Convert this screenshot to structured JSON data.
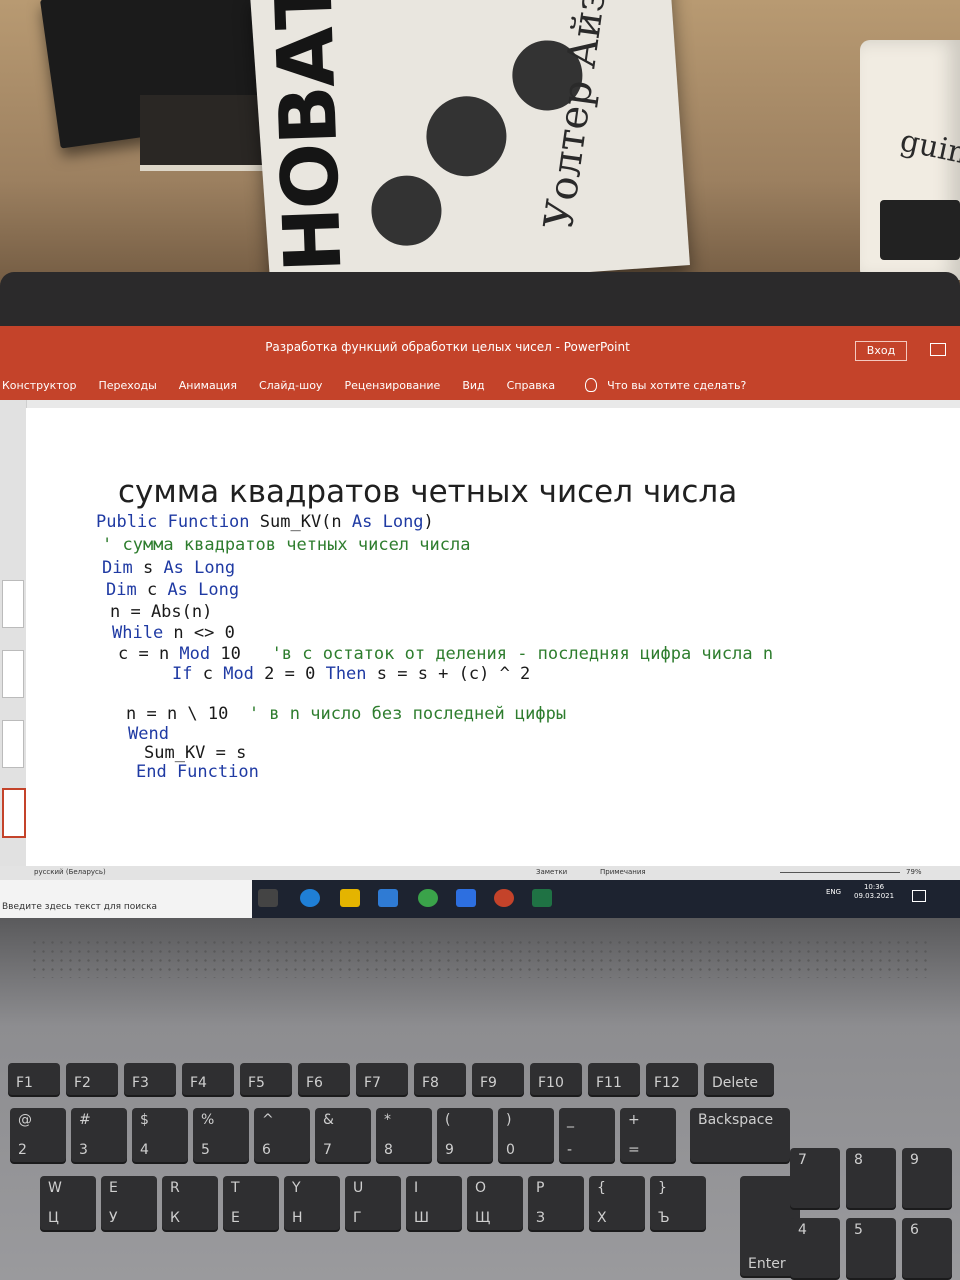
{
  "book": {
    "big_letters": "НОВАТОРЫ",
    "author": "Уолтер Айзексон"
  },
  "mug_text": "guin",
  "window": {
    "title": "Разработка функций обработки целых чисел  -  PowerPoint",
    "signin": "Вход",
    "tabs": [
      "Конструктор",
      "Переходы",
      "Анимация",
      "Слайд-шоу",
      "Рецензирование",
      "Вид",
      "Справка"
    ],
    "tell_me": "Что вы хотите сделать?"
  },
  "slide": {
    "title": "сумма квадратов четных чисел числа",
    "code": [
      {
        "parts": [
          [
            "kw",
            "Public Function"
          ],
          [
            "tx",
            " Sum_KV(n "
          ],
          [
            "kw",
            "As Long"
          ],
          [
            "tx",
            ")"
          ]
        ]
      },
      {
        "parts": [
          [
            "cm",
            "' сумма квадратов четных чисел числа"
          ]
        ]
      },
      {
        "parts": [
          [
            "kw",
            "Dim"
          ],
          [
            "tx",
            " s "
          ],
          [
            "kw",
            "As Long"
          ]
        ]
      },
      {
        "parts": [
          [
            "kw",
            "Dim"
          ],
          [
            "tx",
            " c "
          ],
          [
            "kw",
            "As Long"
          ]
        ]
      },
      {
        "parts": [
          [
            "tx",
            "n = Abs(n)"
          ]
        ]
      },
      {
        "parts": [
          [
            "kw",
            "While"
          ],
          [
            "tx",
            " n <> 0"
          ]
        ]
      },
      {
        "parts": [
          [
            "tx",
            "c = n "
          ],
          [
            "kw",
            "Mod"
          ],
          [
            "tx",
            " 10   "
          ],
          [
            "cm",
            "'в с остаток от деления - последняя цифра числа n"
          ]
        ]
      },
      {
        "parts": [
          [
            "kw",
            "If"
          ],
          [
            "tx",
            " c "
          ],
          [
            "kw",
            "Mod"
          ],
          [
            "tx",
            " 2 = 0 "
          ],
          [
            "kw",
            "Then"
          ],
          [
            "tx",
            " s = s + (c) ^ 2"
          ]
        ]
      },
      {
        "parts": [
          [
            "tx",
            "n = n \\ 10  "
          ],
          [
            "cm",
            "' в n число без последней цифры"
          ]
        ]
      },
      {
        "parts": [
          [
            "kw",
            "Wend"
          ]
        ]
      },
      {
        "parts": [
          [
            "tx",
            "Sum_KV = s"
          ]
        ]
      },
      {
        "parts": [
          [
            "kw",
            "End Function"
          ]
        ]
      }
    ]
  },
  "status": {
    "language": "русский (Беларусь)",
    "notes": "Заметки",
    "comments": "Примечания",
    "zoom": "79%"
  },
  "taskbar": {
    "search_placeholder": "Введите здесь текст для поиска",
    "lang": "ENG",
    "time": "10:36",
    "date": "09.03.2021"
  },
  "keyboard": {
    "fn_row": [
      "F1",
      "F2",
      "F3",
      "F4",
      "F5",
      "F6",
      "F7",
      "F8",
      "F9",
      "F10",
      "F11",
      "F12",
      "Delete"
    ],
    "num_row": [
      [
        "@",
        "2"
      ],
      [
        "#",
        "3"
      ],
      [
        "$",
        "4"
      ],
      [
        "%",
        "5"
      ],
      [
        "^",
        "6"
      ],
      [
        "&",
        "7"
      ],
      [
        "*",
        "8"
      ],
      [
        "(",
        "9"
      ],
      [
        ")",
        "0"
      ],
      [
        "_",
        "-"
      ],
      [
        "+",
        "="
      ]
    ],
    "letter_row": [
      [
        "W",
        "Ц"
      ],
      [
        "E",
        "У"
      ],
      [
        "R",
        "К"
      ],
      [
        "T",
        "Е"
      ],
      [
        "Y",
        "Н"
      ],
      [
        "U",
        "Г"
      ],
      [
        "I",
        "Ш"
      ],
      [
        "O",
        "Щ"
      ],
      [
        "P",
        "З"
      ],
      [
        "{",
        "Х"
      ],
      [
        "}",
        "Ъ"
      ]
    ],
    "backspace": "Backspace",
    "enter": "Enter",
    "numpad": [
      "7",
      "8",
      "9",
      "4",
      "5",
      "6"
    ]
  }
}
